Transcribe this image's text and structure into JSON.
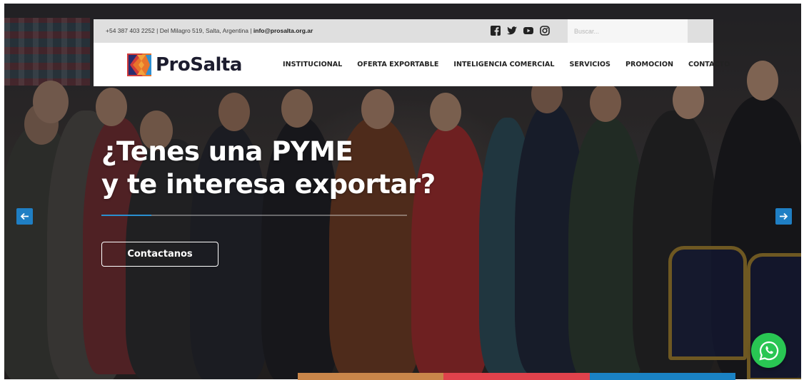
{
  "topbar": {
    "phone_address": "+54 387 403 2252 | Del Milagro 519, Salta, Argentina |",
    "email": "info@prosalta.org.ar",
    "social": [
      "facebook-icon",
      "twitter-icon",
      "youtube-icon",
      "instagram-icon"
    ],
    "search_placeholder": "Buscar..."
  },
  "brand": {
    "name": "ProSalta"
  },
  "nav": {
    "items": [
      "INSTITUCIONAL",
      "OFERTA EXPORTABLE",
      "INTELIGENCIA COMERCIAL",
      "SERVICIOS",
      "PROMOCION",
      "CONTACTO"
    ]
  },
  "hero": {
    "line1": "¿Tenes una PYME",
    "line2": "y te interesa exportar?",
    "cta": "Contactanos"
  },
  "colors": {
    "accent_blue": "#1f7fc4",
    "whatsapp_green": "#29c653",
    "tab_orange": "#c9864a",
    "tab_red": "#e0424c",
    "tab_blue": "#1a82c4"
  }
}
